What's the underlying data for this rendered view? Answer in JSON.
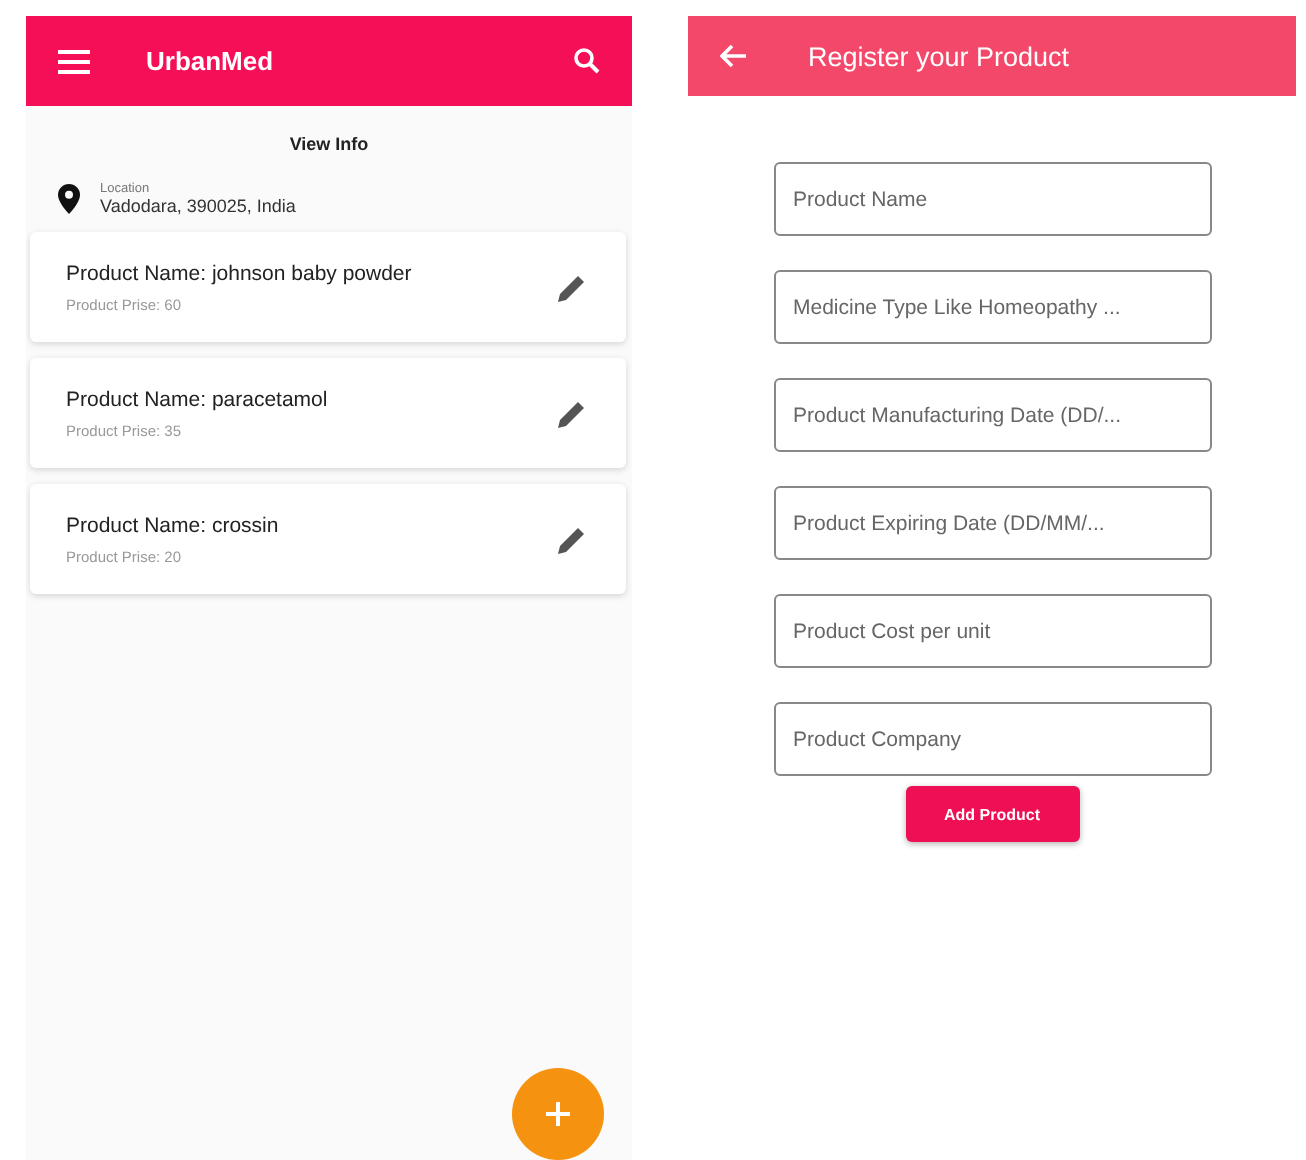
{
  "list_screen": {
    "app_bar": {
      "title": "UrbanMed"
    },
    "heading": "View Info",
    "location": {
      "label": "Location",
      "value": "Vadodara, 390025, India"
    },
    "products": [
      {
        "name": "Product Name: johnson baby powder",
        "price": "Product Prise: 60"
      },
      {
        "name": "Product Name: paracetamol",
        "price": "Product Prise: 35"
      },
      {
        "name": "Product Name: crossin",
        "price": "Product Prise: 20"
      }
    ]
  },
  "register_screen": {
    "app_bar": {
      "title": "Register your Product"
    },
    "fields": [
      {
        "placeholder": "Product Name"
      },
      {
        "placeholder": "Medicine Type Like Homeopathy ..."
      },
      {
        "placeholder": "Product Manufacturing Date (DD/..."
      },
      {
        "placeholder": "Product Expiring Date (DD/MM/..."
      },
      {
        "placeholder": "Product Cost per unit"
      },
      {
        "placeholder": "Product Company"
      }
    ],
    "button": "Add Product"
  }
}
